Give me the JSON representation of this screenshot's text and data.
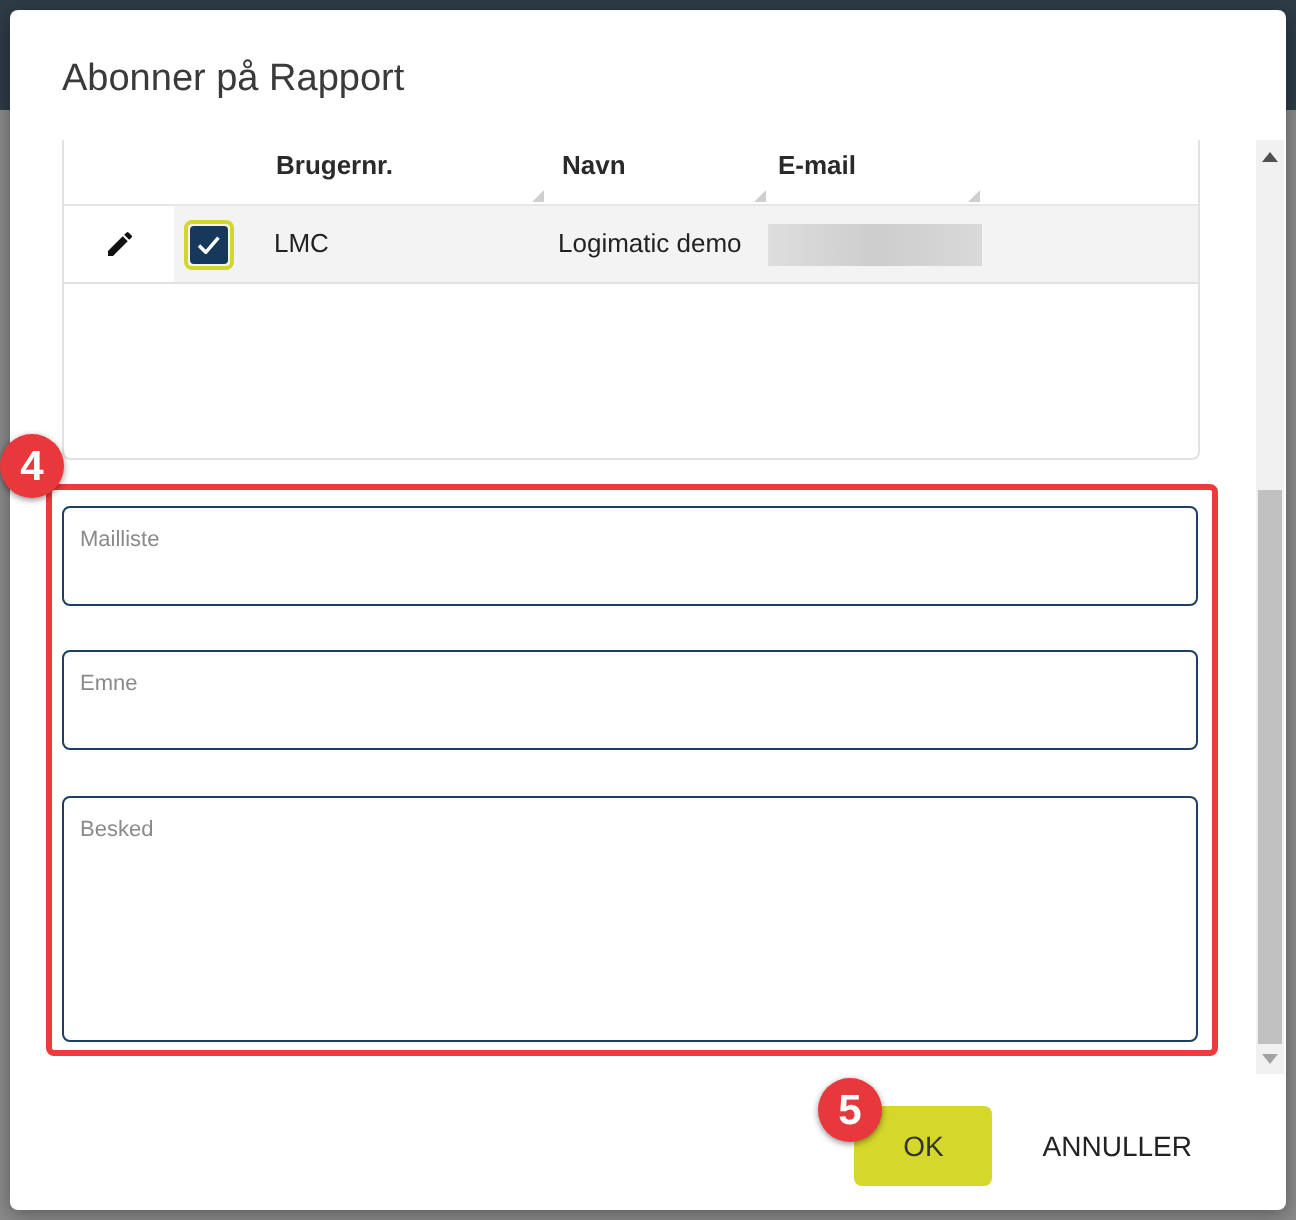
{
  "dialog": {
    "title": "Abonner på Rapport"
  },
  "table": {
    "columns": [
      {
        "label": "Brugernr."
      },
      {
        "label": "Navn"
      },
      {
        "label": "E-mail"
      }
    ],
    "rows": [
      {
        "selected": true,
        "checked": true,
        "cells": [
          "LMC",
          "Logimatic demo"
        ]
      }
    ]
  },
  "form": {
    "highlighted": true,
    "callout": "4",
    "fields": [
      {
        "kind": "input",
        "label": "Mailliste"
      },
      {
        "kind": "input",
        "label": "Emne"
      },
      {
        "kind": "textarea",
        "label": "Besked"
      }
    ]
  },
  "buttons": [
    {
      "kind": "primary",
      "label": "OK",
      "callout": "5"
    },
    {
      "kind": "text",
      "label": "ANNULLER"
    }
  ]
}
